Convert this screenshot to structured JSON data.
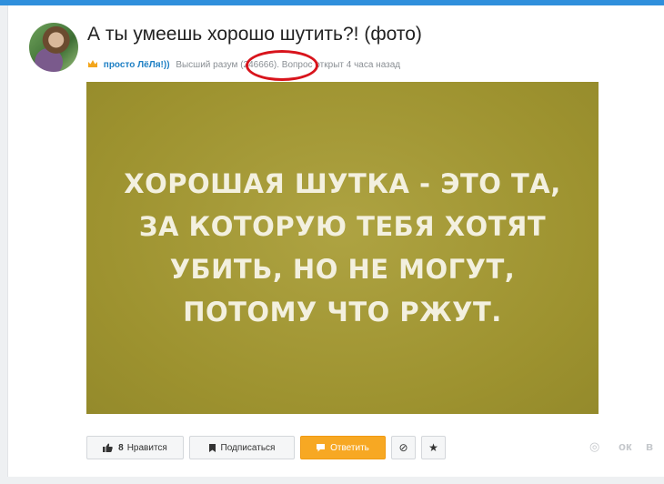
{
  "question": {
    "title": "А ты умеешь хорошо шутить?! (фото)",
    "author": "просто ЛёЛя!))",
    "rank": "Высший разум",
    "points": "(246666).",
    "status": "Вопрос открыт 4 часа назад"
  },
  "image": {
    "lines": [
      "ХОРОШАЯ ШУТКА - ЭТО ТА,",
      "ЗА КОТОРУЮ ТЕБЯ ХОТЯТ",
      "УБИТЬ, НО НЕ МОГУТ,",
      "ПОТОМУ ЧТО РЖУТ."
    ]
  },
  "actions": {
    "like_count": "8",
    "like_label": "Нравится",
    "subscribe_label": "Подписаться",
    "answer_label": "Ответить",
    "hide_glyph": "⊘",
    "favorite_glyph": "★"
  },
  "social": {
    "icon_1": "◎",
    "icon_2": "ок",
    "icon_3": "в"
  },
  "colors": {
    "accent_blue": "#2f8fdc",
    "author_link": "#1d7fc4",
    "answer_button": "#f7a823",
    "annotation_circle": "#d8141c",
    "photo_background": "#a59a3a"
  }
}
